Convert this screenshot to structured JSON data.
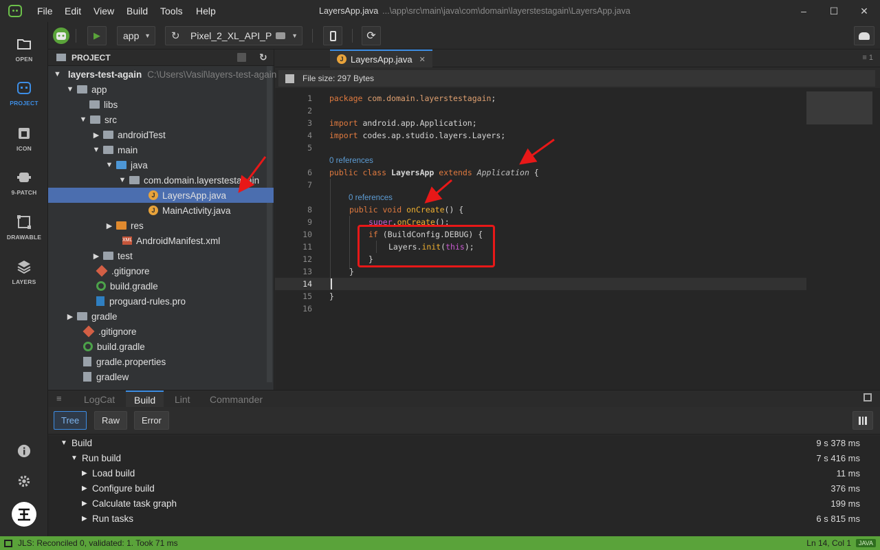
{
  "menu": [
    "File",
    "Edit",
    "View",
    "Build",
    "Tools",
    "Help"
  ],
  "window": {
    "file": "LayersApp.java",
    "path": "...\\app\\src\\main\\java\\com\\domain\\layerstestagain\\LayersApp.java"
  },
  "sidebar": {
    "items": [
      {
        "label": "OPEN",
        "icon": "folder-icon"
      },
      {
        "label": "PROJECT",
        "icon": "robot-icon"
      },
      {
        "label": "ICON",
        "icon": "android-icon"
      },
      {
        "label": "9-PATCH",
        "icon": "patch-icon"
      },
      {
        "label": "DRAWABLE",
        "icon": "drawable-icon"
      },
      {
        "label": "LAYERS",
        "icon": "layers-icon"
      }
    ]
  },
  "toolbar": {
    "module": "app",
    "device": "Pixel_2_XL_API_P"
  },
  "project": {
    "title": "PROJECT",
    "root_path": "C:\\Users\\Vasil\\layers-test-again",
    "tree": [
      {
        "label": "layers-test-again"
      },
      {
        "label": "app"
      },
      {
        "label": "libs"
      },
      {
        "label": "src"
      },
      {
        "label": "androidTest"
      },
      {
        "label": "main"
      },
      {
        "label": "java"
      },
      {
        "label": "com.domain.layerstestagain"
      },
      {
        "label": "LayersApp.java"
      },
      {
        "label": "MainActivity.java"
      },
      {
        "label": "res"
      },
      {
        "label": "AndroidManifest.xml"
      },
      {
        "label": "test"
      },
      {
        "label": ".gitignore"
      },
      {
        "label": "build.gradle"
      },
      {
        "label": "proguard-rules.pro"
      },
      {
        "label": "gradle"
      },
      {
        "label": ".gitignore"
      },
      {
        "label": "build.gradle"
      },
      {
        "label": "gradle.properties"
      },
      {
        "label": "gradlew"
      }
    ]
  },
  "editor": {
    "tab": "LayersApp.java",
    "file_size": "File size: 297 Bytes",
    "references": "0 references",
    "code": {
      "pkg_kw": "package",
      "pkg_name": "com.domain.layerstestagain",
      "imp_kw": "import",
      "imp1": "android.app.Application;",
      "imp2": "codes.ap.studio.layers.Layers;",
      "public": "public",
      "class": "class",
      "classname": "LayersApp",
      "extends": "extends",
      "superclass": "Application",
      "void": "void",
      "method": "onCreate",
      "super": "super",
      "superCall": "onCreate",
      "if": "if",
      "cond": "(BuildConfig.DEBUG) {",
      "layers": "Layers.",
      "init": "init",
      "this": "this"
    },
    "line_numbers": [
      "1",
      "2",
      "3",
      "4",
      "5",
      "6",
      "7",
      "8",
      "9",
      "10",
      "11",
      "12",
      "13",
      "14",
      "15",
      "16"
    ]
  },
  "bottom": {
    "tabs": [
      "LogCat",
      "Build",
      "Lint",
      "Commander"
    ],
    "filters": [
      "Tree",
      "Raw",
      "Error"
    ],
    "build_rows": [
      {
        "label": "Build",
        "time": "9 s 378 ms"
      },
      {
        "label": "Run build",
        "time": "7 s 416 ms"
      },
      {
        "label": "Load build",
        "time": "11 ms"
      },
      {
        "label": "Configure build",
        "time": "376 ms"
      },
      {
        "label": "Calculate task graph",
        "time": "199 ms"
      },
      {
        "label": "Run tasks",
        "time": "6 s 815 ms"
      }
    ]
  },
  "status": {
    "message": "JLS: Reconciled 0, validated: 1. Took 71 ms",
    "position": "Ln 14, Col 1",
    "lang": "JAVA"
  },
  "colors": {
    "accent": "#3d8ee6",
    "status": "#5aa33a",
    "annotation": "#e81818"
  }
}
